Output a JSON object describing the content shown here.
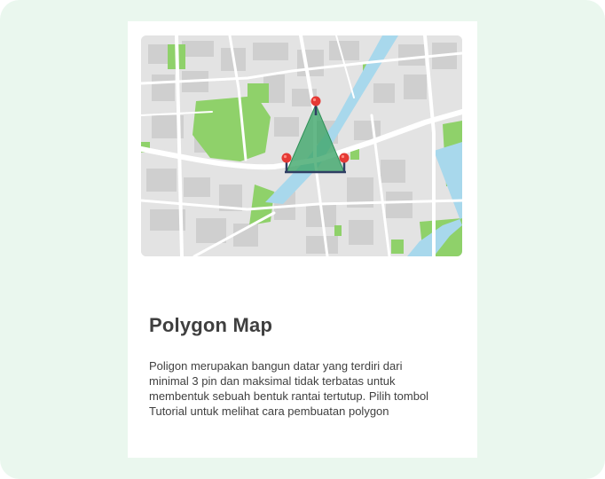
{
  "card": {
    "title": "Polygon Map",
    "description": "Poligon merupakan bangun datar yang terdiri dari minimal 3 pin dan maksimal tidak terbatas untuk membentuk sebuah bentuk rantai tertutup. Pilih tombol Tutorial untuk melihat cara pembuatan polygon"
  },
  "map": {
    "pin_count": 3,
    "colors": {
      "background": "#e3e3e3",
      "block": "#cfcfcf",
      "road": "#ffffff",
      "park": "#8fd16a",
      "river": "#a8d8ec",
      "polygon_fill": "#3fa66a",
      "pin": "#e53935"
    }
  },
  "theme": {
    "page_background": "#eaf7ee",
    "card_background": "#ffffff",
    "text": "#3f3f3f"
  }
}
